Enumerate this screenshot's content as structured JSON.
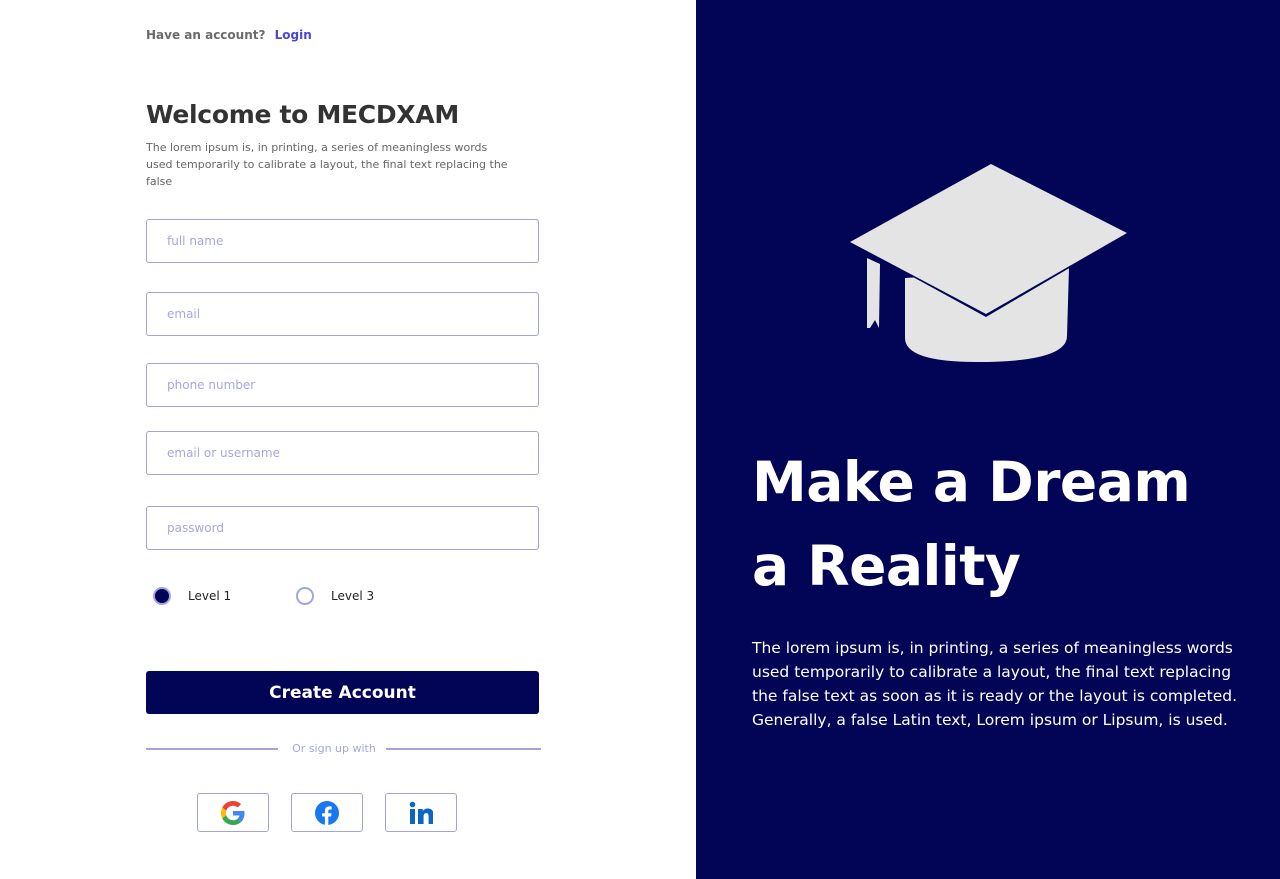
{
  "header": {
    "have_account_text": "Have an account?",
    "login_link": "Login"
  },
  "form": {
    "title": "Welcome to MECDXAM",
    "subtitle": "The lorem ipsum is, in printing, a series of meaningless words used temporarily to calibrate a layout, the final text replacing the false",
    "fields": {
      "full_name_placeholder": "full name",
      "email_placeholder": "email",
      "phone_placeholder": "phone number",
      "username_placeholder": "email or username",
      "password_placeholder": "password"
    },
    "levels": [
      {
        "label": "Level 1",
        "checked": true
      },
      {
        "label": "Level 3",
        "checked": false
      }
    ],
    "create_button": "Create Account",
    "or_sign_up_text": "Or sign up with",
    "social": [
      {
        "name": "google",
        "icon": "google-icon"
      },
      {
        "name": "facebook",
        "icon": "facebook-icon"
      },
      {
        "name": "linkedin",
        "icon": "linkedin-icon"
      }
    ]
  },
  "hero": {
    "icon": "graduation-cap-icon",
    "line1": "Make a Dream",
    "line2": "a Reality",
    "description": "The lorem ipsum is, in printing, a series of meaningless words used temporarily to calibrate a layout, the final text replacing the false text as soon as it is ready or the layout is completed. Generally, a false Latin text, Lorem ipsum or Lipsum, is used."
  },
  "colors": {
    "primary": "#020456",
    "accent_link": "#4a46d6",
    "field_border": "#a3a2dc",
    "cap": "#e4e4e4"
  }
}
